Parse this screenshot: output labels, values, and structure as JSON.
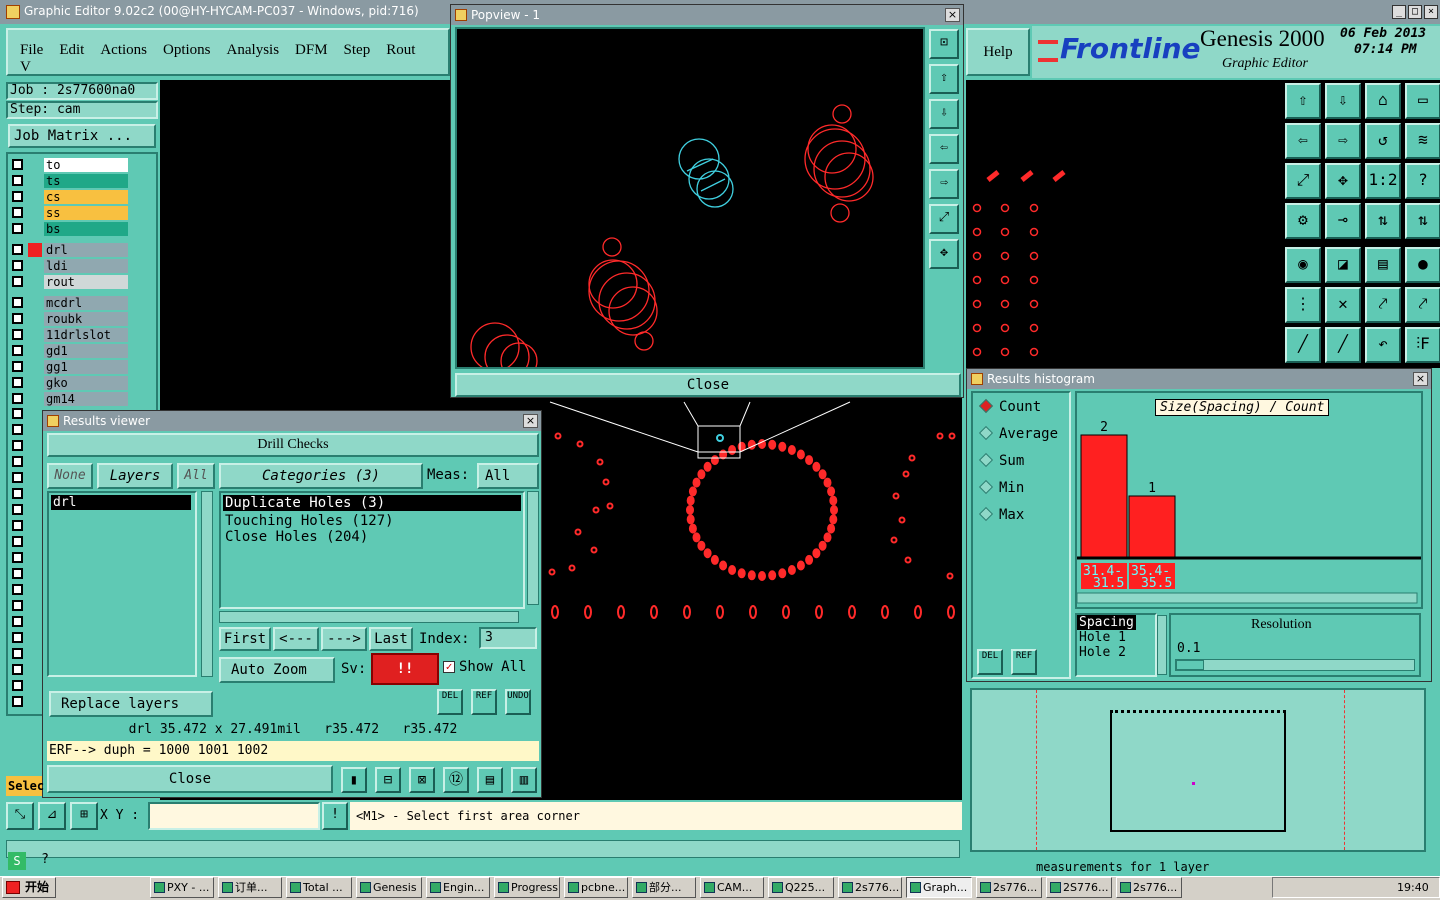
{
  "main_window": {
    "title": "Graphic Editor 9.02c2 (00@HY-HYCAM-PC037 - Windows, pid:716)",
    "menu": [
      "File",
      "Edit",
      "Actions",
      "Options",
      "Analysis",
      "DFM",
      "Step",
      "Rout",
      "V"
    ],
    "help": "Help"
  },
  "brand": {
    "logo": "Frontline",
    "product": "Genesis 2000",
    "subtitle": "Graphic Editor",
    "date": "06 Feb 2013",
    "time": "07:14 PM"
  },
  "job": {
    "job_label": "Job : 2s77600na0",
    "step_label": "Step: cam",
    "matrix_button": "Job Matrix ..."
  },
  "layers": [
    {
      "name": "to",
      "color": "#ffffff"
    },
    {
      "name": "ts",
      "color": "#20a888"
    },
    {
      "name": "cs",
      "color": "#f8c040"
    },
    {
      "name": "ss",
      "color": "#f8c040"
    },
    {
      "name": "bs",
      "color": "#20a888"
    },
    {
      "name": "drl",
      "color": "#90a8b0"
    },
    {
      "name": "ldi",
      "color": "#90a8b0"
    },
    {
      "name": "rout",
      "color": "#d0d8d8"
    },
    {
      "name": "mcdrl",
      "color": "#90a8b0"
    },
    {
      "name": "roubk",
      "color": "#90a8b0"
    },
    {
      "name": "11drlslot",
      "color": "#90a8b0"
    },
    {
      "name": "gd1",
      "color": "#90a8b0"
    },
    {
      "name": "gg1",
      "color": "#90a8b0"
    },
    {
      "name": "gko",
      "color": "#90a8b0"
    },
    {
      "name": "gm14",
      "color": "#90a8b0"
    }
  ],
  "popview": {
    "title": "Popview - 1",
    "close": "Close"
  },
  "results_viewer": {
    "title": "Results viewer",
    "header": "Drill Checks",
    "none": "None",
    "layers": "Layers",
    "all": "All",
    "categories": "Categories (3)",
    "meas_label": "Meas:",
    "meas_value": "All",
    "layer_list": [
      "drl"
    ],
    "category_list": [
      "Duplicate Holes (3)",
      "Touching Holes (127)",
      "Close Holes (204)"
    ],
    "first": "First",
    "prev": "<---",
    "next": "--->",
    "last": "Last",
    "index_label": "Index:",
    "index_value": "3",
    "auto_zoom": "Auto Zoom",
    "sv": "Sv:",
    "sv_value": "!!",
    "show_all": "Show All",
    "replace_layers": "Replace layers",
    "del": "DEL",
    "ref": "REF",
    "undo": "UNDO",
    "measure": "drl 35.472 x 27.491mil   r35.472   r35.472",
    "erf": "ERF--> duph = 1000 1001 1002",
    "close": "Close"
  },
  "histogram": {
    "title": "Results histogram",
    "options": [
      "Count",
      "Average",
      "Sum",
      "Min",
      "Max"
    ],
    "chart_title": "Size(Spacing) / Count",
    "list": [
      "Spacing",
      "Hole 1",
      "Hole 2"
    ],
    "resolution_label": "Resolution",
    "resolution_value": "0.1",
    "del": "DEL",
    "ref": "REF"
  },
  "chart_data": {
    "type": "bar",
    "title": "Size(Spacing) / Count",
    "categories": [
      "31.4-31.5",
      "35.4-35.5"
    ],
    "values": [
      2,
      1
    ],
    "ylim": [
      0,
      2
    ]
  },
  "status": {
    "xy_label": "X Y :",
    "xy_value": "",
    "prompt": "<M1> - Select first area corner",
    "sel": "Selec",
    "bottom_text": "measurements for 1 layer"
  },
  "taskbar": {
    "start": "开始",
    "items": [
      "PXY - ...",
      "订单...",
      "Total ...",
      "Genesis",
      "Engin...",
      "Progress",
      "pcbne...",
      "部分...",
      "CAM...",
      "Q225...",
      "2s776...",
      "Graph...",
      "2s776...",
      "2S776...",
      "2s776..."
    ],
    "clock": "19:40"
  },
  "colors": {
    "teal": "#5fc9b4",
    "drill": "#ff2a2a",
    "cyan": "#40d0e0"
  }
}
